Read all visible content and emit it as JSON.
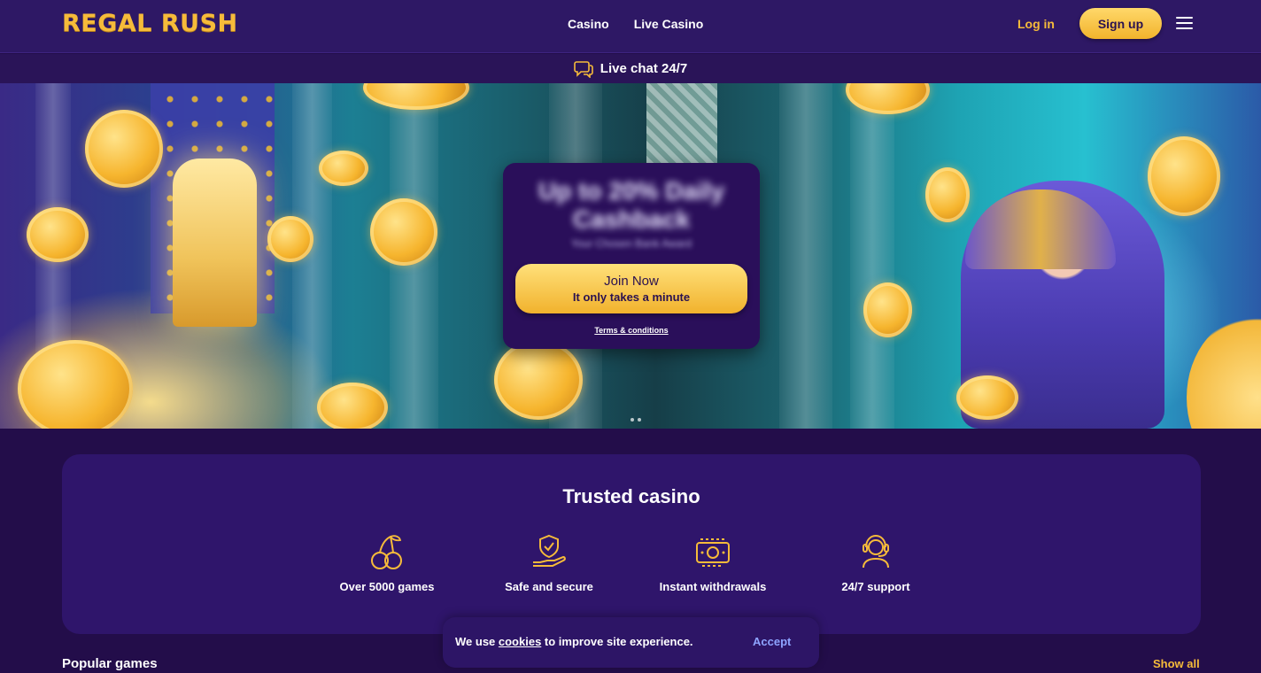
{
  "header": {
    "logo": "REGAL RUSH",
    "nav": [
      "Casino",
      "Live Casino"
    ],
    "login": "Log in",
    "signup": "Sign up"
  },
  "chatbar": {
    "label": "Live chat 24/7"
  },
  "hero": {
    "promo_headline": "Up to 20% Daily Cashback",
    "promo_subtext": "Your Chosen Bank Award",
    "join_line1": "Join Now",
    "join_line2": "It only takes a minute",
    "terms": "Terms & conditions"
  },
  "trusted": {
    "title": "Trusted casino",
    "features": [
      {
        "label": "Over 5000 games",
        "icon": "cherries-icon"
      },
      {
        "label": "Safe and secure",
        "icon": "shield-hand-icon"
      },
      {
        "label": "Instant withdrawals",
        "icon": "cash-icon"
      },
      {
        "label": "24/7 support",
        "icon": "headset-icon"
      }
    ]
  },
  "popular": {
    "title": "Popular games",
    "show_all": "Show all"
  },
  "cookie": {
    "prefix": "We use ",
    "link": "cookies",
    "suffix": " to improve site experience.",
    "accept": "Accept"
  },
  "colors": {
    "accent_gold": "#f6bb3a",
    "header_bg": "#2e1865",
    "page_bg": "#230d4a",
    "card_bg": "#2f156b",
    "accept_link": "#8ea4ff"
  }
}
